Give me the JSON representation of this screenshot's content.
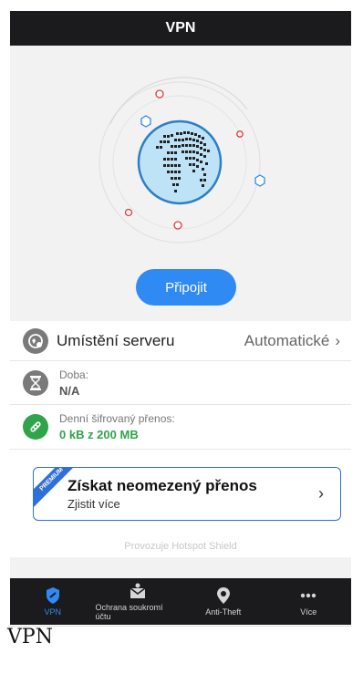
{
  "header": {
    "title": "VPN"
  },
  "hero": {
    "connect_label": "Připojit"
  },
  "server": {
    "label": "Umístění serveru",
    "value": "Automatické"
  },
  "duration": {
    "label": "Doba:",
    "value": "N/A"
  },
  "traffic": {
    "label": "Denní šifrovaný přenos:",
    "value": "0 kB z 200 MB"
  },
  "promo": {
    "ribbon": "PREMIUM",
    "title": "Získat neomezený přenos",
    "subtitle": "Zjistit více"
  },
  "footer": {
    "powered": "Provozuje Hotspot Shield"
  },
  "tabs": [
    {
      "label": "VPN"
    },
    {
      "label": "Ochrana soukromí účtu"
    },
    {
      "label": "Anti-Theft"
    },
    {
      "label": "Více"
    }
  ],
  "caption": "VPN",
  "colors": {
    "accent": "#2f8af4",
    "green": "#2fa44a",
    "dark": "#1b1b1d",
    "promo_border": "#2f6fd8"
  }
}
